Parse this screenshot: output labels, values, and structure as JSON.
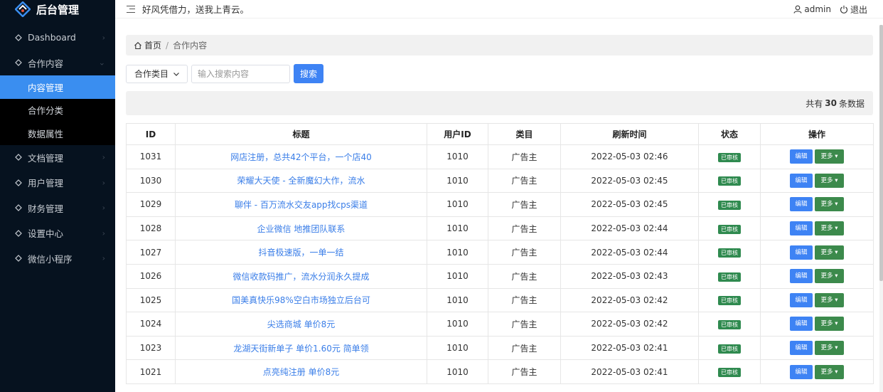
{
  "app": {
    "title": "后台管理",
    "accent": "#3a8ef0"
  },
  "topbar": {
    "slogan": "好风凭借力，送我上青云。",
    "user": "admin",
    "logout": "退出"
  },
  "sidebar": {
    "items": [
      {
        "label": "Dashboard",
        "icon": "diamond-icon"
      },
      {
        "label": "合作内容",
        "icon": "diamond-icon",
        "children": [
          {
            "label": "内容管理",
            "active": true
          },
          {
            "label": "合作分类",
            "active": false
          },
          {
            "label": "数据属性",
            "active": false
          }
        ]
      },
      {
        "label": "文档管理",
        "icon": "diamond-icon"
      },
      {
        "label": "用户管理",
        "icon": "diamond-icon"
      },
      {
        "label": "财务管理",
        "icon": "diamond-icon"
      },
      {
        "label": "设置中心",
        "icon": "diamond-icon"
      },
      {
        "label": "微信小程序",
        "icon": "diamond-icon"
      }
    ]
  },
  "breadcrumb": {
    "home": "首页",
    "separator": "/",
    "current": "合作内容"
  },
  "filters": {
    "category_label": "合作类目",
    "search_placeholder": "输入搜索内容",
    "search_button": "搜索"
  },
  "summary": {
    "prefix": "共有",
    "count": "30",
    "suffix": "条数据"
  },
  "table": {
    "headers": [
      "ID",
      "标题",
      "用户ID",
      "类目",
      "刷新时间",
      "状态",
      "操作"
    ],
    "status_label": "已审核",
    "edit_label": "编辑",
    "more_label": "更多",
    "rows": [
      {
        "id": "1031",
        "title": "网店注册，总共42个平台，一个店40",
        "uid": "1010",
        "cat": "广告主",
        "time": "2022-05-03 02:46"
      },
      {
        "id": "1030",
        "title": "荣耀大天使 - 全新魔幻大作，流水",
        "uid": "1010",
        "cat": "广告主",
        "time": "2022-05-03 02:45"
      },
      {
        "id": "1029",
        "title": "聊伴 - 百万流水交友app找cps渠道",
        "uid": "1010",
        "cat": "广告主",
        "time": "2022-05-03 02:45"
      },
      {
        "id": "1028",
        "title": "企业微信 地推团队联系",
        "uid": "1010",
        "cat": "广告主",
        "time": "2022-05-03 02:44"
      },
      {
        "id": "1027",
        "title": "抖音极速版，一单一结",
        "uid": "1010",
        "cat": "广告主",
        "time": "2022-05-03 02:44"
      },
      {
        "id": "1026",
        "title": "微信收款码推广，流水分润永久提成",
        "uid": "1010",
        "cat": "广告主",
        "time": "2022-05-03 02:43"
      },
      {
        "id": "1025",
        "title": "国美真快乐98%空白市场独立后台可",
        "uid": "1010",
        "cat": "广告主",
        "time": "2022-05-03 02:42"
      },
      {
        "id": "1024",
        "title": "尖选商城 单价8元",
        "uid": "1010",
        "cat": "广告主",
        "time": "2022-05-03 02:42"
      },
      {
        "id": "1023",
        "title": "龙湖天街新单子 单价1.60元 简单领",
        "uid": "1010",
        "cat": "广告主",
        "time": "2022-05-03 02:41"
      },
      {
        "id": "1021",
        "title": "点亮纯注册 单价8元",
        "uid": "1010",
        "cat": "广告主",
        "time": "2022-05-03 02:41"
      }
    ]
  }
}
